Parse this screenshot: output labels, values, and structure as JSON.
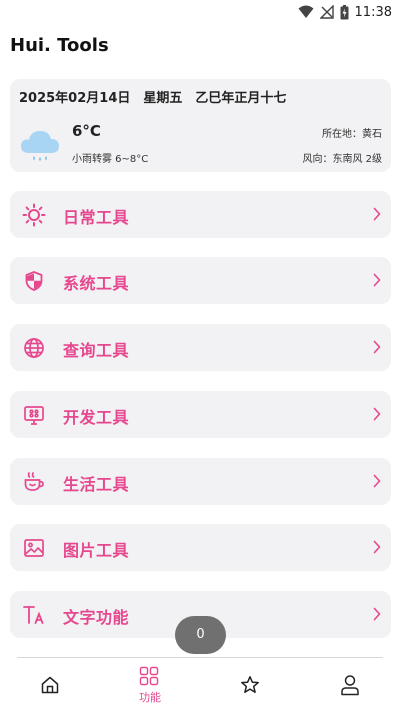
{
  "status_bar": {
    "time": "11:38",
    "icons": [
      "wifi-icon",
      "signal-off-icon",
      "battery-charging-icon"
    ]
  },
  "app": {
    "title": "Hui. Tools"
  },
  "weather": {
    "date": "2025年02月14日",
    "weekday": "星期五",
    "lunar": "乙巳年正月十七",
    "temp": "6°C",
    "desc": "小雨转雾 6~8°C",
    "location": "所在地：黄石",
    "wind": "风向：东南风 2级",
    "icon": "rain-cloud-icon"
  },
  "menu": [
    {
      "label": "日常工具",
      "icon": "sun-icon"
    },
    {
      "label": "系统工具",
      "icon": "shield-icon"
    },
    {
      "label": "查询工具",
      "icon": "globe-icon"
    },
    {
      "label": "开发工具",
      "icon": "monitor-icon"
    },
    {
      "label": "生活工具",
      "icon": "coffee-cup-icon"
    },
    {
      "label": "图片工具",
      "icon": "image-icon"
    },
    {
      "label": "文字功能",
      "icon": "text-icon"
    }
  ],
  "toast": {
    "text": "0"
  },
  "bottom_nav": [
    {
      "label": "",
      "icon": "home-icon"
    },
    {
      "label": "功能",
      "icon": "grid-icon",
      "active": true
    },
    {
      "label": "",
      "icon": "star-icon"
    },
    {
      "label": "",
      "icon": "user-icon"
    }
  ],
  "colors": {
    "accent": "#e6488f",
    "card_bg": "#f2f1f3",
    "nav_inactive": "#222222"
  }
}
